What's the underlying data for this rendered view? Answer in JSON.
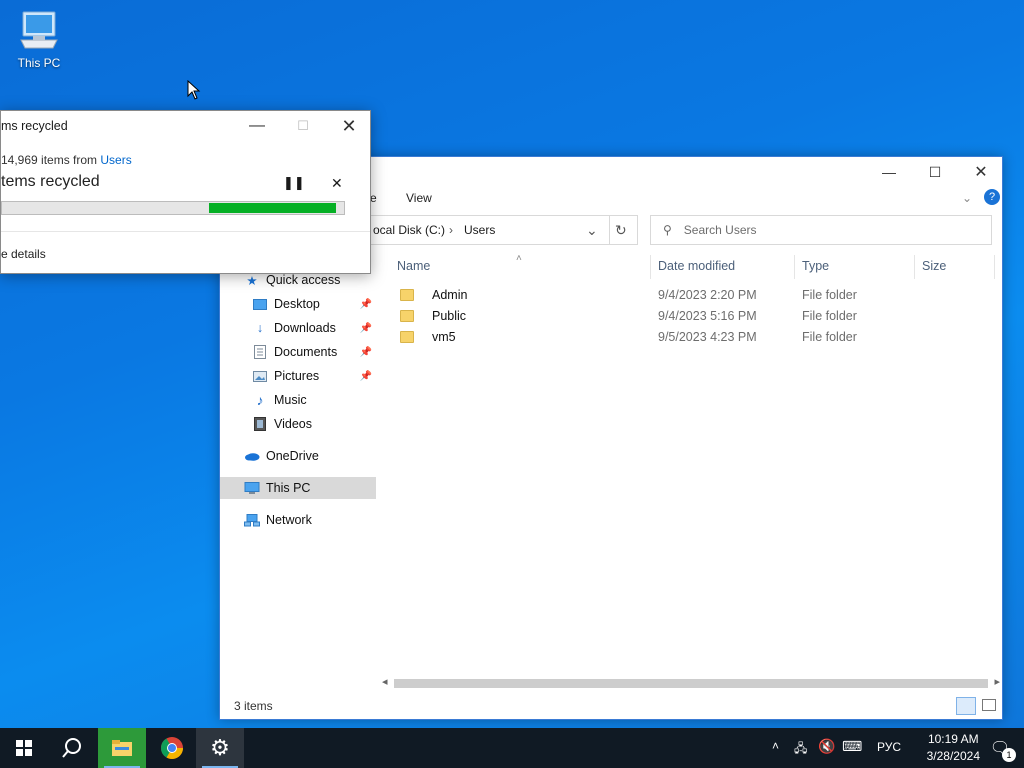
{
  "desktop": {
    "icons": [
      {
        "label": "This PC"
      }
    ]
  },
  "progress_dialog": {
    "title": "ms recycled",
    "subtitle_prefix": " 14,969 items from ",
    "subtitle_link": "Users",
    "big_status": "tems recycled",
    "progress_fraction": 0.37,
    "details_label": "e details",
    "accent": "#06b025"
  },
  "explorer": {
    "ribbon_tabs": [
      "e",
      "View"
    ],
    "address": {
      "segment1": "ocal Disk (C:)",
      "segment2": "Users"
    },
    "search_placeholder": "Search Users",
    "nav": {
      "quick_access": "Quick access",
      "items": [
        {
          "label": "Desktop",
          "pinned": true
        },
        {
          "label": "Downloads",
          "pinned": true
        },
        {
          "label": "Documents",
          "pinned": true
        },
        {
          "label": "Pictures",
          "pinned": true
        },
        {
          "label": "Music",
          "pinned": false
        },
        {
          "label": "Videos",
          "pinned": false
        }
      ],
      "onedrive": "OneDrive",
      "this_pc": "This PC",
      "network": "Network"
    },
    "columns": {
      "name": "Name",
      "date": "Date modified",
      "type": "Type",
      "size": "Size"
    },
    "rows": [
      {
        "name": "Admin",
        "date": "9/4/2023 2:20 PM",
        "type": "File folder"
      },
      {
        "name": "Public",
        "date": "9/4/2023 5:16 PM",
        "type": "File folder"
      },
      {
        "name": "vm5",
        "date": "9/5/2023 4:23 PM",
        "type": "File folder"
      }
    ],
    "status": "3 items"
  },
  "taskbar": {
    "language": "РУС",
    "time": "10:19 AM",
    "date": "3/28/2024",
    "notification_count": "1"
  }
}
